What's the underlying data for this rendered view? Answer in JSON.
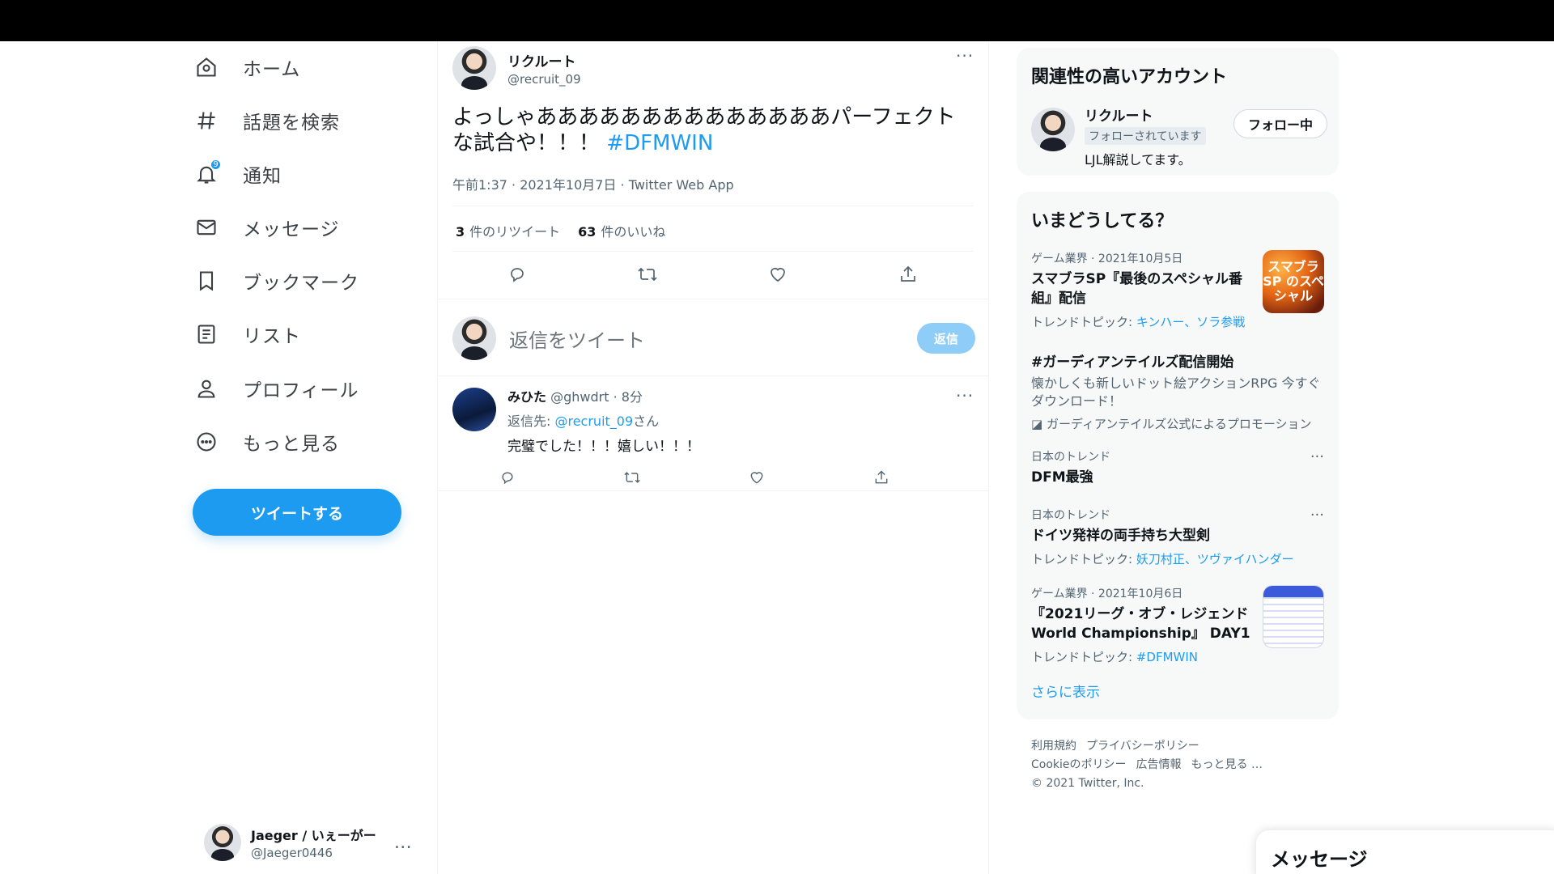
{
  "nav": {
    "items": [
      {
        "label": "ホーム",
        "icon": "home-icon"
      },
      {
        "label": "話題を検索",
        "icon": "hashtag-icon"
      },
      {
        "label": "通知",
        "icon": "bell-icon",
        "badge": "9"
      },
      {
        "label": "メッセージ",
        "icon": "mail-icon"
      },
      {
        "label": "ブックマーク",
        "icon": "bookmark-icon"
      },
      {
        "label": "リスト",
        "icon": "list-icon"
      },
      {
        "label": "プロフィール",
        "icon": "user-icon"
      },
      {
        "label": "もっと見る",
        "icon": "more-circle-icon"
      }
    ],
    "tweet_button": "ツイートする"
  },
  "account": {
    "display_name": "Jaeger / いぇーがー",
    "handle": "@Jaeger0446",
    "more": "…"
  },
  "tweet": {
    "display_name": "リクルート",
    "handle": "@recruit_09",
    "text": "よっしゃああああああああああああああパーフェクトな試合や！！！",
    "hashtag": "#DFMWIN",
    "meta": "午前1:37 · 2021年10月7日 · Twitter Web App",
    "retweets_count": "3",
    "retweets_label": "件のリツイート",
    "likes_count": "63",
    "likes_label": "件のいいね"
  },
  "reply_box": {
    "placeholder": "返信をツイート",
    "button": "返信"
  },
  "reply": {
    "display_name": "みひた",
    "handle_time": "@ghwdrt · 8分",
    "reply_to_prefix": "返信先: ",
    "reply_to_handle": "@recruit_09",
    "reply_to_suffix": "さん",
    "text": "完璧でした！！！嬉しい！！！"
  },
  "related": {
    "title": "関連性の高いアカウント",
    "display_name": "リクルート",
    "follows_you": "フォローされています",
    "bio": "LJL解説してます。",
    "follow_button": "フォロー中"
  },
  "trends": {
    "title": "いまどうしてる？",
    "items": [
      {
        "category": "ゲーム業界 · 2021年10月5日",
        "title": "スマブラSP『最後のスペシャル番組』配信",
        "topic_prefix": "トレンドトピック: ",
        "topic_links": "キンハー、ソラ参戦",
        "thumb_text": "スマブラSP のスペシャル"
      },
      {
        "category": "",
        "title": "#ガーディアンテイルズ配信開始",
        "desc": "懐かしくも新しいドット絵アクションRPG 今すぐダウンロード！",
        "promo": "ガーディアンテイルズ公式によるプロモーション"
      },
      {
        "category": "日本のトレンド",
        "title": "DFM最強"
      },
      {
        "category": "日本のトレンド",
        "title": "ドイツ発祥の両手持ち大型剣",
        "topic_prefix": "トレンドトピック: ",
        "topic_links": "妖刀村正、ツヴァイハンダー"
      },
      {
        "category": "ゲーム業界 · 2021年10月6日",
        "title": "『2021リーグ・オブ・レジェンド World Championship』 DAY1",
        "topic_prefix": "トレンドトピック: ",
        "topic_links": "#DFMWIN"
      }
    ],
    "show_more": "さらに表示"
  },
  "footer": {
    "line1": [
      "利用規約",
      "プライバシーポリシー"
    ],
    "line2": [
      "Cookieのポリシー",
      "広告情報",
      "もっと見る …"
    ],
    "copyright": "© 2021 Twitter, Inc."
  },
  "messages_drawer": {
    "title": "メッセージ"
  },
  "colors": {
    "accent": "#1d9bf0",
    "text": "#0f1419",
    "muted": "#536471"
  }
}
